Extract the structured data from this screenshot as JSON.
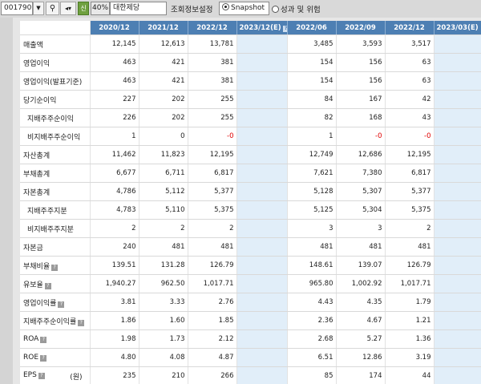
{
  "toolbar": {
    "code": "001790",
    "percent": "40%",
    "company": "대한제당",
    "settings_label": "조회정보설정",
    "radio_snapshot": "Snapshot",
    "radio_risk": "성과 및 위험"
  },
  "header": {
    "columns": [
      "2020/12",
      "2021/12",
      "2022/12",
      "2023/12(E)",
      "2022/06",
      "2022/09",
      "2022/12",
      "2023/03(E)"
    ]
  },
  "rows": [
    {
      "label": "매출액",
      "values": [
        "12,145",
        "12,613",
        "13,781",
        "",
        "3,485",
        "3,593",
        "3,517",
        ""
      ]
    },
    {
      "label": "영업이익",
      "values": [
        "463",
        "421",
        "381",
        "",
        "154",
        "156",
        "63",
        ""
      ]
    },
    {
      "label": "영업이익(발표기준)",
      "values": [
        "463",
        "421",
        "381",
        "",
        "154",
        "156",
        "63",
        ""
      ]
    },
    {
      "label": "당기순이익",
      "values": [
        "227",
        "202",
        "255",
        "",
        "84",
        "167",
        "42",
        ""
      ]
    },
    {
      "label": "지배주주순이익",
      "values": [
        "226",
        "202",
        "255",
        "",
        "82",
        "168",
        "43",
        ""
      ]
    },
    {
      "label": "비지배주주순이익",
      "values": [
        "1",
        "0",
        "-0",
        "",
        "1",
        "-0",
        "-0",
        ""
      ]
    },
    {
      "label": "자산총계",
      "values": [
        "11,462",
        "11,823",
        "12,195",
        "",
        "12,749",
        "12,686",
        "12,195",
        ""
      ]
    },
    {
      "label": "부채총계",
      "values": [
        "6,677",
        "6,711",
        "6,817",
        "",
        "7,621",
        "7,380",
        "6,817",
        ""
      ]
    },
    {
      "label": "자본총계",
      "values": [
        "4,786",
        "5,112",
        "5,377",
        "",
        "5,128",
        "5,307",
        "5,377",
        ""
      ]
    },
    {
      "label": "지배주주지분",
      "values": [
        "4,783",
        "5,110",
        "5,375",
        "",
        "5,125",
        "5,304",
        "5,375",
        ""
      ]
    },
    {
      "label": "비지배주주지분",
      "values": [
        "2",
        "2",
        "2",
        "",
        "3",
        "3",
        "2",
        ""
      ]
    },
    {
      "label": "자본금",
      "values": [
        "240",
        "481",
        "481",
        "",
        "481",
        "481",
        "481",
        ""
      ]
    },
    {
      "label": "부채비율",
      "values": [
        "139.51",
        "131.28",
        "126.79",
        "",
        "148.61",
        "139.07",
        "126.79",
        ""
      ]
    },
    {
      "label": "유보율",
      "values": [
        "1,940.27",
        "962.50",
        "1,017.71",
        "",
        "965.80",
        "1,002.92",
        "1,017.71",
        ""
      ]
    },
    {
      "label": "영업이익률",
      "values": [
        "3.81",
        "3.33",
        "2.76",
        "",
        "4.43",
        "4.35",
        "1.79",
        ""
      ]
    },
    {
      "label": "지배주주순이익률",
      "values": [
        "1.86",
        "1.60",
        "1.85",
        "",
        "2.36",
        "4.67",
        "1.21",
        ""
      ]
    },
    {
      "label": "ROA",
      "values": [
        "1.98",
        "1.73",
        "2.12",
        "",
        "2.68",
        "5.27",
        "1.36",
        ""
      ]
    },
    {
      "label": "ROE",
      "values": [
        "4.80",
        "4.08",
        "4.87",
        "",
        "6.51",
        "12.86",
        "3.19",
        ""
      ]
    },
    {
      "label": "EPS",
      "unit": "(원)",
      "values": [
        "235",
        "210",
        "266",
        "",
        "85",
        "174",
        "44",
        ""
      ]
    }
  ],
  "colors": {
    "header_bg": "#4d7fb3",
    "estimate_bg": "#e1eef9",
    "negative": "#e00000"
  }
}
